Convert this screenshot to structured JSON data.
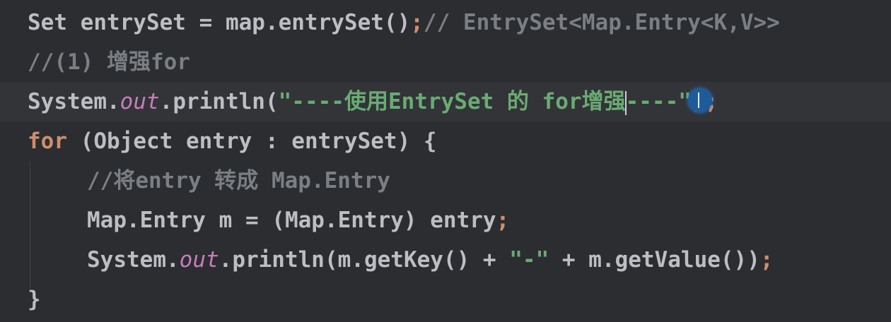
{
  "code": {
    "line1": {
      "a": "Set entrySet = map.entrySet()",
      "semi": ";",
      "comment": "// EntrySet<Map.Entry<K,V>>"
    },
    "line2": {
      "comment": "//(1) 增强for"
    },
    "line3": {
      "a": "System.",
      "field": "out",
      "b": ".println(",
      "str1": "\"----使用EntrySet 的 for增强",
      "str2": "----\"",
      "c": ")",
      "semi": ";"
    },
    "line4": {
      "kw": "for",
      "a": " (Object entry : entrySet) {"
    },
    "line5": {
      "comment": "//将entry 转成 Map.Entry"
    },
    "line6": {
      "a": "Map.Entry m = (Map.Entry) entry",
      "semi": ";"
    },
    "line7": {
      "a": "System.",
      "field": "out",
      "b": ".println(m.getKey() + ",
      "str": "\"-\"",
      "c": " + m.getValue())",
      "semi": ";"
    },
    "line8": {
      "a": "}"
    }
  },
  "colors": {
    "background": "#2b2d30",
    "current_line": "#323438",
    "keyword": "#cf8e6d",
    "comment": "#7a7e85",
    "string": "#6aab73",
    "field": "#c77dbb",
    "plain": "#bcbec4"
  },
  "icons": {
    "mouse_cursor": "text-cursor-icon"
  }
}
